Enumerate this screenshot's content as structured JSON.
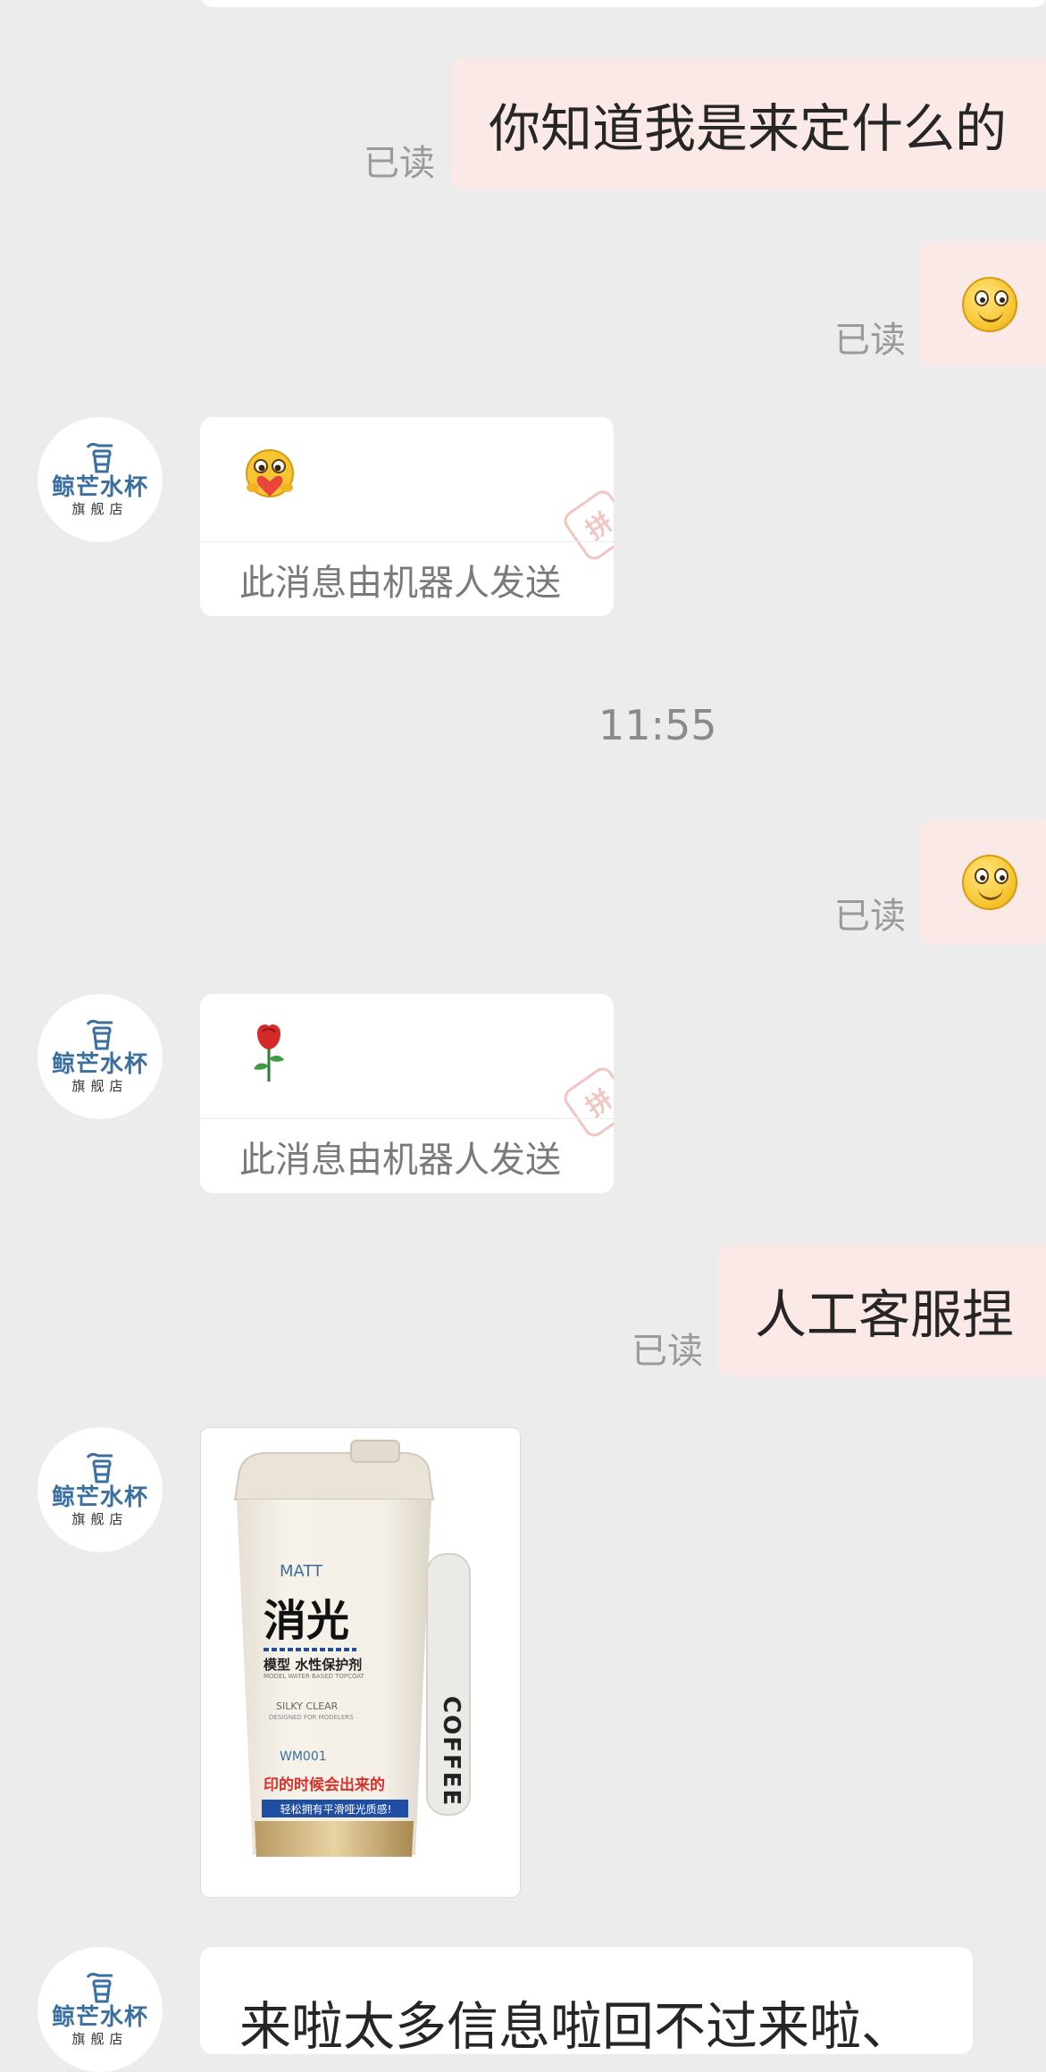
{
  "messages": {
    "msg1_text": "你知道我是来定什么的",
    "read_label": "已读",
    "bot_note": "此消息由机器人发送",
    "timestamp": "11:55",
    "msg_human_text": "人工客服捏",
    "last_text": "来啦太多信息啦回不过来啦、"
  },
  "shop": {
    "brand": "鲸芒水杯",
    "sub": "旗舰店",
    "stamp_glyph": "拼"
  },
  "product": {
    "cup_label_top": "MATT",
    "cup_title": "消光",
    "cup_subtitle": "模型 水性保护剂",
    "cup_subtitle_en": "MODEL WATER BASED TOPCOAT",
    "cup_finish": "SILKY CLEAR",
    "cup_finish_note": "DESIGNED FOR MODELERS",
    "cup_code": "WM001",
    "cup_red_line": "印的时候会出来的",
    "cup_band": "轻松拥有平滑哑光质感!",
    "strap_text": "COFFEE"
  },
  "colors": {
    "background": "#ececec",
    "outgoing_bubble": "#fbe9e7",
    "incoming_bubble": "#ffffff",
    "brand_blue": "#3b6fa0"
  },
  "icons": {
    "smile": "smiling-face-emoji",
    "hug": "hugging-heart-emoji",
    "rose": "rose-emoji",
    "cup": "cup-logo-icon"
  }
}
